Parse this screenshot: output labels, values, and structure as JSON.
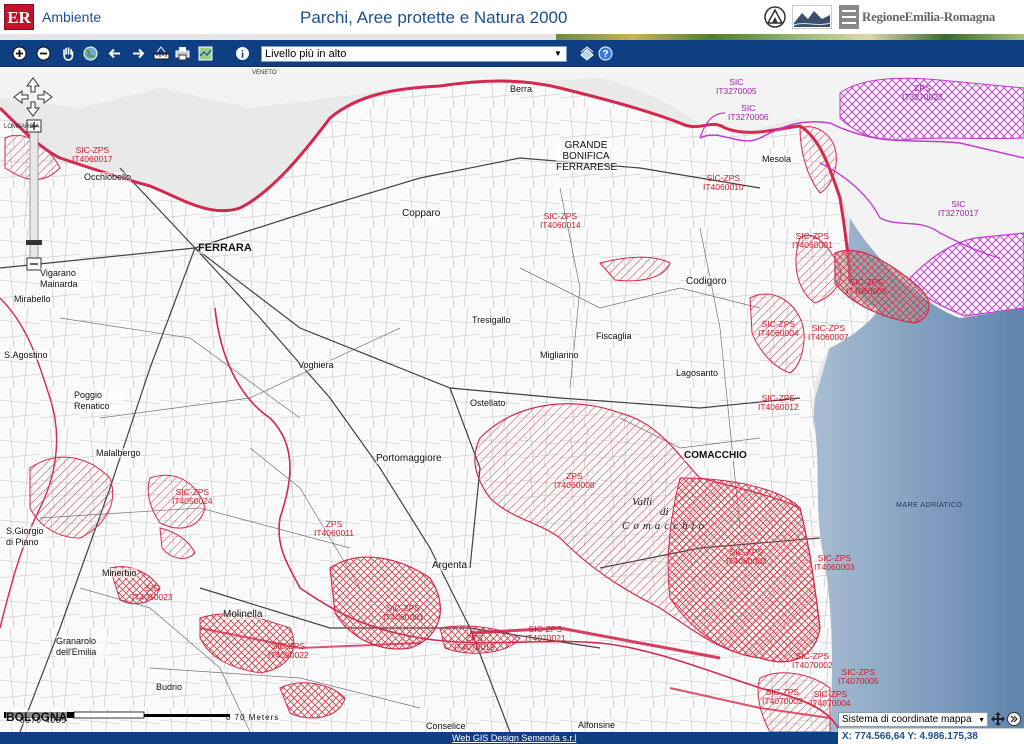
{
  "header": {
    "logo": "ER",
    "section": "Ambiente",
    "title": "Parchi, Aree protette e Natura 2000",
    "region": "RegioneEmilia-Romagna"
  },
  "toolbar": {
    "tools": [
      "zoom-in-icon",
      "zoom-out-icon",
      "pan-hand-icon",
      "globe-icon",
      "back-arrow-icon",
      "forward-arrow-icon",
      "measure-icon",
      "print-icon",
      "map-export-icon",
      "info-icon"
    ],
    "layer_select": "Livello più in alto",
    "right_tools": [
      "legend-icon",
      "help-icon"
    ]
  },
  "map": {
    "region_labels": {
      "veneto": "VENETO",
      "lombardia": "LOMBARDIA",
      "sea": "MARE ADRIATICO"
    },
    "towns": {
      "ferrara": "FERRARA",
      "copparo": "Copparo",
      "codigoro": "Codigoro",
      "mesola": "Mesola",
      "ostellato": "Ostellato",
      "portomaggiore": "Portomaggiore",
      "comacchio": "COMACCHIO",
      "argenta": "Argenta",
      "molinella": "Molinella",
      "minerbio": "Minerbio",
      "budrio": "Budrio",
      "granarolo": "Granarolo dell'Emilia",
      "vigarano": "Vigarano Mainarda",
      "poggio": "Poggio Renatico",
      "malalbergo": "Malalbergo",
      "fiscaglia": "Fiscaglia",
      "alfonsine": "Alfonsine",
      "conselice": "Conselice",
      "occhiobello": "Occhiobello",
      "berra": "Berra",
      "tresigallo": "Tresigallo",
      "voghiera": "Voghiera",
      "migliarino": "Migliarino",
      "lagosanto": "Lagosanto",
      "bologna": "BOLOGNA",
      "gorgio": "S.Giorgio di Piano",
      "mirabello": "Mirabello",
      "sagostino": "S.Agostino",
      "bonifica_grande": "GRANDE BONIFICA FERRARESE"
    },
    "valli": {
      "l1": "Valli",
      "l2": "di",
      "l3": "Comacchio"
    },
    "sites": [
      {
        "code": "SIC-ZPS",
        "id": "IT4060017"
      },
      {
        "code": "SIC",
        "id": "IT3270005"
      },
      {
        "code": "SIC",
        "id": "IT3270006"
      },
      {
        "code": "ZPS",
        "id": "IT3270023"
      },
      {
        "code": "SIC",
        "id": "IT3270017"
      },
      {
        "code": "SIC-ZPS",
        "id": "IT4060010"
      },
      {
        "code": "SIC-ZPS",
        "id": "IT4060014"
      },
      {
        "code": "SIC-ZPS",
        "id": "IT4060001"
      },
      {
        "code": "SIC-ZPS",
        "id": "IT4060005"
      },
      {
        "code": "SIC-ZPS",
        "id": "IT4060004"
      },
      {
        "code": "SIC-ZPS",
        "id": "IT4060007"
      },
      {
        "code": "SIC-ZPS",
        "id": "IT4060012"
      },
      {
        "code": "ZPS",
        "id": "IT4060008"
      },
      {
        "code": "SIC-ZPS",
        "id": "IT4050024"
      },
      {
        "code": "ZPS",
        "id": "IT4060011"
      },
      {
        "code": "SIC-ZPS",
        "id": "IT4060002"
      },
      {
        "code": "SIC-ZPS",
        "id": "IT4060003"
      },
      {
        "code": "SIC-ZPS",
        "id": "IT4060001"
      },
      {
        "code": "SIC",
        "id": "IT4050023"
      },
      {
        "code": "SIC-ZPS",
        "id": "IT4050022"
      },
      {
        "code": "ZPS",
        "id": "IT4070019"
      },
      {
        "code": "SIC-ZPS",
        "id": "IT4070021"
      },
      {
        "code": "SIC-ZPS",
        "id": "IT4070002"
      },
      {
        "code": "SIC-ZPS",
        "id": "IT4070005"
      },
      {
        "code": "SIC-ZPS",
        "id": "IT4070004"
      },
      {
        "code": "SIC-ZPS",
        "id": "IT4070003"
      }
    ],
    "scale": {
      "left": "8070 4035",
      "right": "0 70 Meters"
    }
  },
  "coord": {
    "system_label": "Sistema di coordinate mappa",
    "readout": "X: 774.566,64 Y: 4.986.175,38"
  },
  "footer": {
    "credit": "Web GIS Design Semenda s.r.l"
  },
  "colors": {
    "header_text": "#1d4f91",
    "toolbar_bg": "#0e3f83",
    "site_red": "#c81f2d",
    "site_purple": "#a01fb0",
    "sea": "#7f9dbb"
  }
}
